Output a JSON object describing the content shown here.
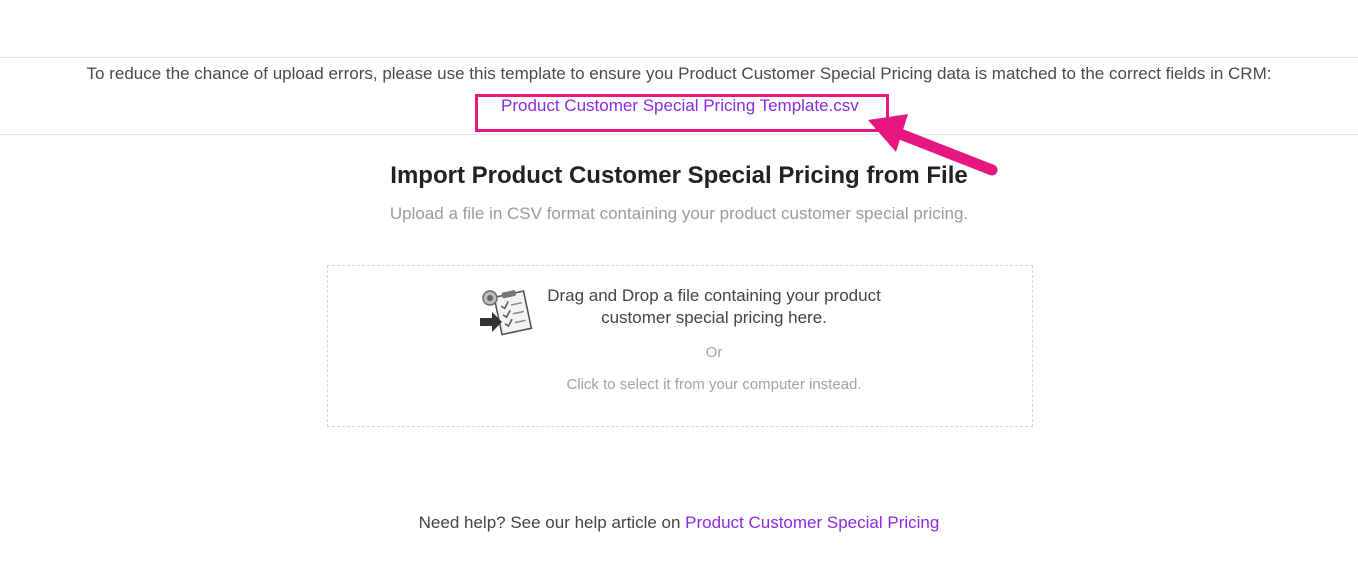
{
  "template_notice": {
    "instructions": "To reduce the chance of upload errors, please use this template to ensure you Product Customer Special Pricing data is matched to the correct fields in CRM:",
    "template_link_label": "Product Customer Special Pricing Template.csv"
  },
  "import": {
    "title": "Import Product Customer Special Pricing from File",
    "subtitle": "Upload a file in CSV format containing your product customer special pricing."
  },
  "dropzone": {
    "icon": "file-upload-checklist-icon",
    "drag_text_line1": "Drag and Drop a file containing your product",
    "drag_text_line2": "customer special pricing here.",
    "or_text": "Or",
    "click_text": "Click to select it from your computer instead."
  },
  "help": {
    "prefix": "Need help? See our help article on ",
    "link_label": "Product Customer Special Pricing"
  },
  "colors": {
    "link": "#8a2be2",
    "highlight": "#e8177f"
  }
}
